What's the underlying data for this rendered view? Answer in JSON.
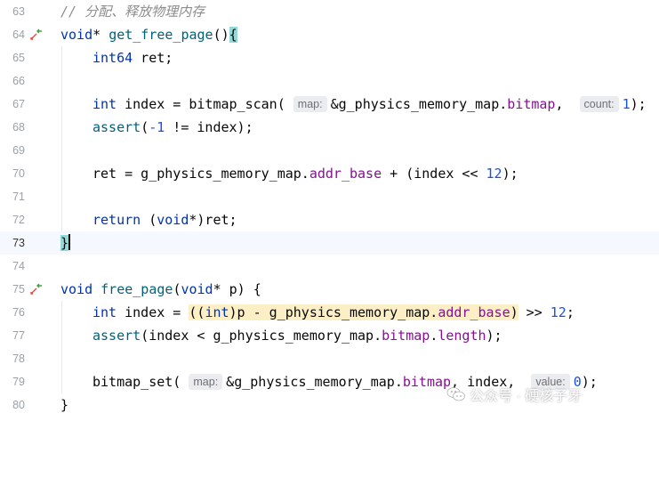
{
  "editor": {
    "lines": [
      {
        "num": "63",
        "text": "// 分配、释放物理内存"
      },
      {
        "num": "64",
        "text": "void* get_free_page(){"
      },
      {
        "num": "65",
        "text": "int64 ret;"
      },
      {
        "num": "66",
        "text": ""
      },
      {
        "num": "67",
        "text": "int index = bitmap_scan(&g_physics_memory_map.bitmap, 1);"
      },
      {
        "num": "68",
        "text": "assert(-1 != index);"
      },
      {
        "num": "69",
        "text": ""
      },
      {
        "num": "70",
        "text": "ret = g_physics_memory_map.addr_base + (index << 12);"
      },
      {
        "num": "71",
        "text": ""
      },
      {
        "num": "72",
        "text": "return (void*)ret;"
      },
      {
        "num": "73",
        "text": "}"
      },
      {
        "num": "74",
        "text": ""
      },
      {
        "num": "75",
        "text": "void free_page(void* p) {"
      },
      {
        "num": "76",
        "text": "int index = ((int)p - g_physics_memory_map.addr_base) >> 12;"
      },
      {
        "num": "77",
        "text": "assert(index < g_physics_memory_map.bitmap.length);"
      },
      {
        "num": "78",
        "text": ""
      },
      {
        "num": "79",
        "text": "bitmap_set(&g_physics_memory_map.bitmap, index, 0);"
      },
      {
        "num": "80",
        "text": "}"
      }
    ],
    "hints": {
      "map": "map:",
      "count": "count:",
      "value": "value:"
    }
  },
  "watermark": {
    "text": "公众号 · 硬核子牙"
  },
  "colors": {
    "keyword": "#0033b3",
    "function": "#00627a",
    "number": "#1750eb",
    "field": "#871094",
    "comment": "#8c8c8c",
    "marker_red": "#d94f4f",
    "marker_green": "#3fa33f"
  }
}
